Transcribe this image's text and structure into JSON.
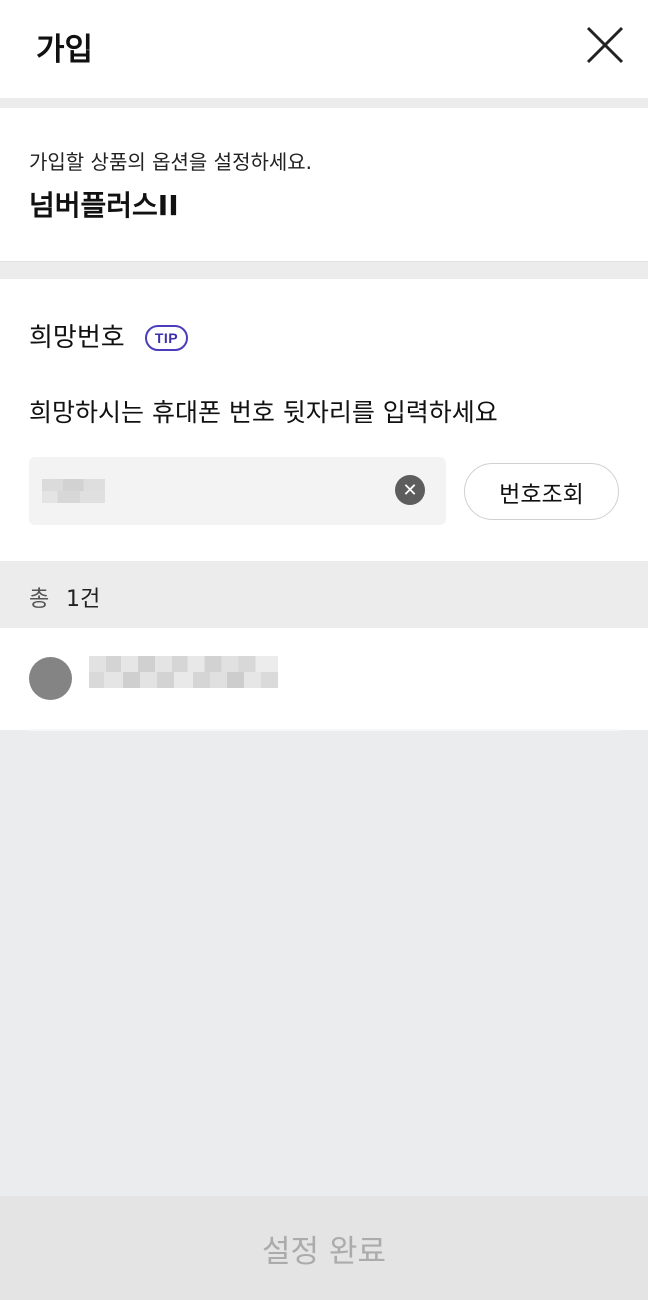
{
  "header": {
    "title": "가입",
    "close_icon": "close-icon"
  },
  "product": {
    "description": "가입할 상품의 옵션을 설정하세요.",
    "name": "넘버플러스II"
  },
  "number_section": {
    "title": "희망번호",
    "tip_label": "TIP",
    "instruction": "희망하시는 휴대폰 번호 뒷자리를 입력하세요",
    "input_value": "",
    "clear_icon": "clear-icon",
    "lookup_button": "번호조회"
  },
  "results": {
    "count_label": "총",
    "count_value": "1건",
    "items": [
      {
        "selected": false,
        "value": ""
      }
    ]
  },
  "footer": {
    "confirm_button": "설정 완료"
  },
  "colors": {
    "tip_accent": "#3c2fae",
    "disabled_button_bg": "#e4e4e4",
    "disabled_button_text": "#ababab",
    "page_background": "#ebecee"
  }
}
